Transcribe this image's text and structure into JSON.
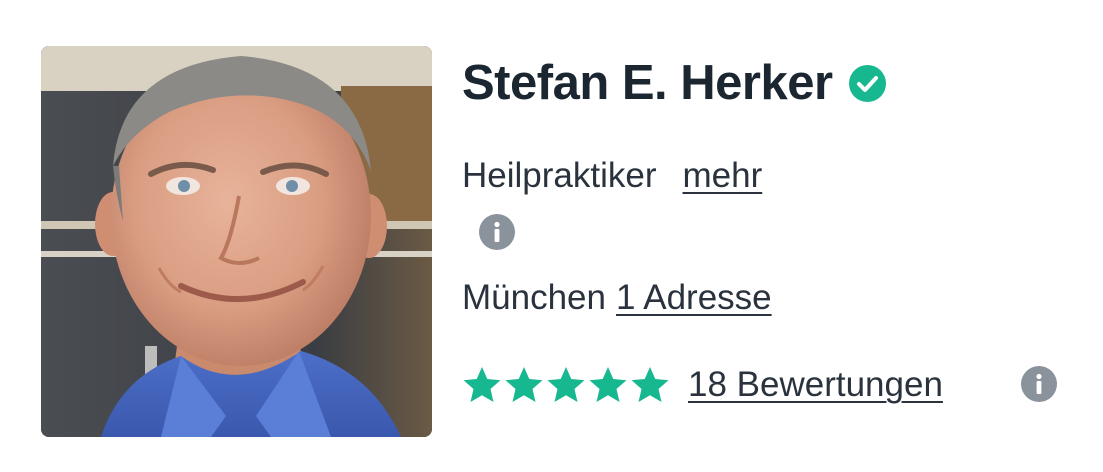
{
  "profile": {
    "name": "Stefan E. Herker",
    "verified": true,
    "specialty": "Heilpraktiker",
    "more_link": "mehr",
    "city": "München",
    "address_link": "1 Adresse",
    "rating": {
      "stars": 5,
      "max_stars": 5,
      "reviews_link": "18 Bewertungen"
    }
  },
  "icons": {
    "verified": "check-circle-icon",
    "info": "info-icon",
    "star": "star-icon"
  },
  "colors": {
    "accent_green": "#17b890",
    "info_gray": "#8a939c",
    "text_dark": "#1b2631"
  }
}
